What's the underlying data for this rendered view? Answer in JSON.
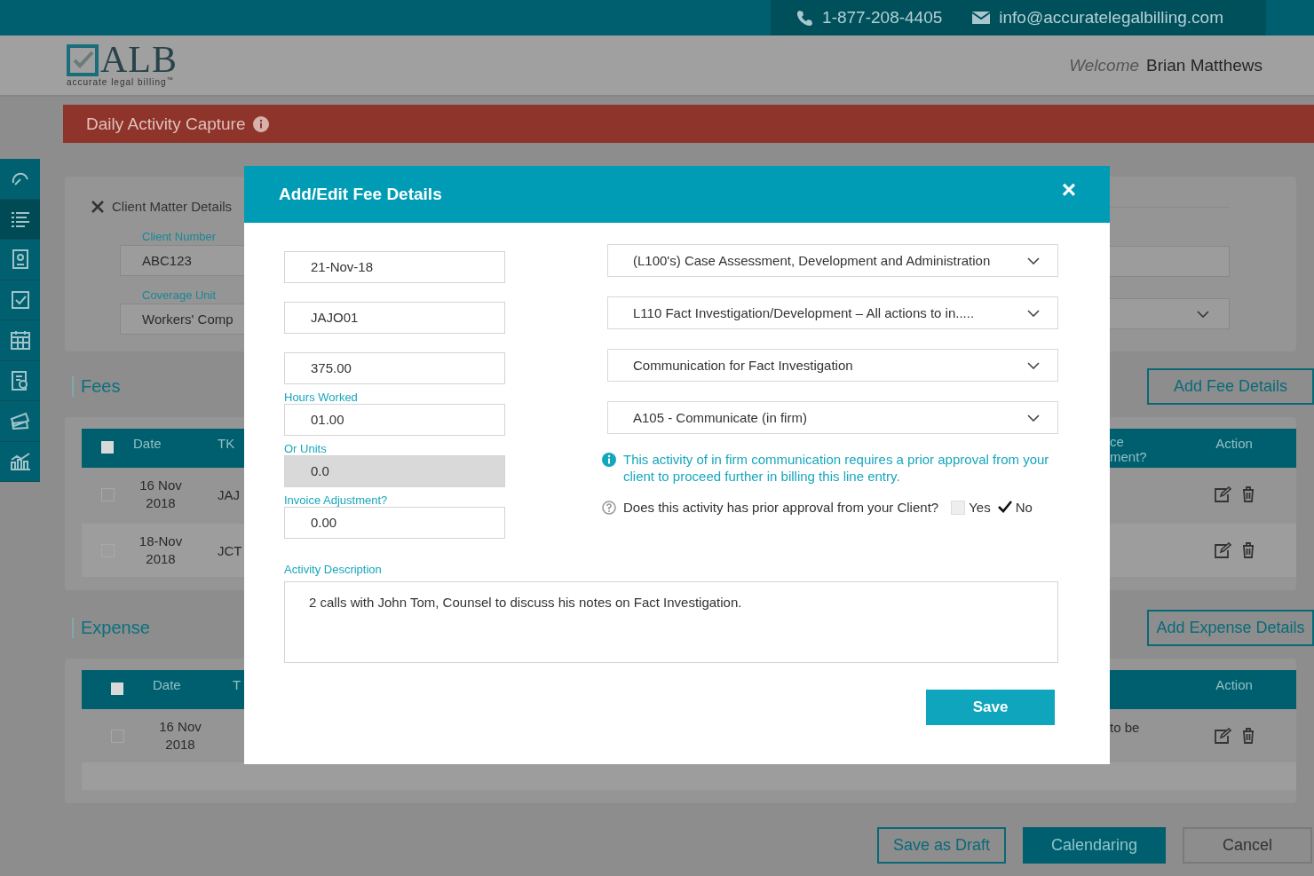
{
  "contact": {
    "phone": "1-877-208-4405",
    "email": "info@accuratelegalbilling.com"
  },
  "logo": {
    "name": "ALB",
    "tagline": "accurate legal billing",
    "trademark": "™"
  },
  "welcome": {
    "greeting": "Welcome",
    "user": "Brian Matthews"
  },
  "page_title": "Daily Activity Capture",
  "sidebar": {
    "items": [
      {
        "selected": false
      },
      {
        "selected": true
      },
      {
        "selected": false
      },
      {
        "selected": false
      },
      {
        "selected": false
      },
      {
        "selected": false
      },
      {
        "selected": false
      },
      {
        "selected": false
      }
    ]
  },
  "client_matter": {
    "title": "Client Matter Details",
    "fields": [
      {
        "label": "Client Number",
        "value": "ABC123"
      },
      {
        "label": "Coverage Unit",
        "value": "Workers' Comp"
      }
    ]
  },
  "fees": {
    "title": "Fees",
    "add_button": "Add Fee Details",
    "all_checked": false,
    "columns": [
      "Date",
      "TK",
      "ce ment?",
      "Action"
    ],
    "rows": [
      {
        "checked": false,
        "date": "16 Nov 2018",
        "tk": "JAJ"
      },
      {
        "checked": false,
        "date": "18-Nov 2018",
        "tk": "JCT"
      }
    ]
  },
  "expense": {
    "title": "Expense",
    "add_button": "Add Expense Details",
    "all_checked": false,
    "columns": [
      "Date",
      "T",
      "Action"
    ],
    "rows": [
      {
        "checked": false,
        "date": "16 Nov 2018",
        "column_4": "to be"
      }
    ]
  },
  "footer_buttons": [
    {
      "label": "Save as Draft",
      "kind": "outline"
    },
    {
      "label": "Calendaring",
      "kind": "primary"
    },
    {
      "label": "Cancel",
      "kind": "plain"
    }
  ],
  "modal": {
    "title": "Add/Edit Fee Details",
    "close": "×",
    "left_fields": [
      {
        "value": "21-Nov-18",
        "disabled": false
      },
      {
        "value": "JAJO01",
        "disabled": false
      },
      {
        "value": "375.00",
        "disabled": false
      },
      {
        "label": "Hours Worked",
        "value": "01.00",
        "disabled": false
      },
      {
        "label": "Or Units",
        "value": "0.0",
        "disabled": true
      },
      {
        "label": "Invoice Adjustment?",
        "value": "0.00",
        "disabled": false
      }
    ],
    "selects": [
      "(L100's) Case Assessment, Development and Administration",
      "L110 Fact Investigation/Development – All actions to in.....",
      "Communication for Fact Investigation",
      "A105 - Communicate (in firm)"
    ],
    "notice": "This activity of in firm communication requires a prior approval from your client to proceed further in billing this line entry.",
    "question": "Does this activity has prior approval from your Client?",
    "options": [
      {
        "label": "Yes",
        "checked": false
      },
      {
        "label": "No",
        "checked": true
      }
    ],
    "description": {
      "label": "Activity Description",
      "value": "2 calls with John Tom, Counsel to discuss his notes on Fact Investigation."
    },
    "save": "Save"
  }
}
